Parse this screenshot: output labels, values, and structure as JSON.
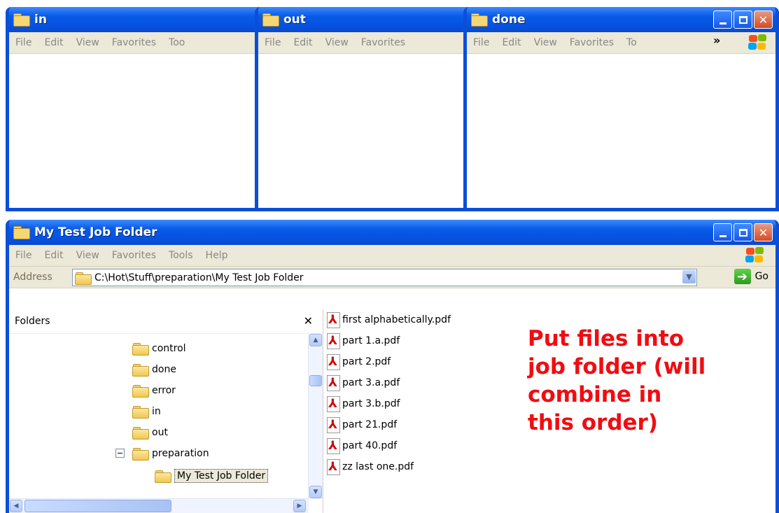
{
  "windows": {
    "in": {
      "title": "in",
      "menu": [
        "File",
        "Edit",
        "View",
        "Favorites",
        "Too"
      ]
    },
    "out": {
      "title": "out",
      "menu": [
        "File",
        "Edit",
        "View",
        "Favorites"
      ]
    },
    "done": {
      "title": "done",
      "menu": [
        "File",
        "Edit",
        "View",
        "Favorites",
        "To"
      ],
      "chevron": "»"
    }
  },
  "main": {
    "title": "My Test Job Folder",
    "menu": [
      "File",
      "Edit",
      "View",
      "Favorites",
      "Tools",
      "Help"
    ],
    "address_label": "Address",
    "address_value": "C:\\Hot\\Stuff\\preparation\\My Test Job Folder",
    "go_label": "Go",
    "folders_pane": {
      "title": "Folders",
      "close_glyph": "✕",
      "items": [
        "control",
        "done",
        "error",
        "in",
        "out",
        "preparation",
        "My Test Job Folder"
      ]
    },
    "files": [
      "first alphabetically.pdf",
      "part 1.a.pdf",
      "part 2.pdf",
      "part 3.a.pdf",
      "part 3.b.pdf",
      "part 21.pdf",
      "part 40.pdf",
      "zz last one.pdf"
    ]
  },
  "annotation": {
    "line1": "Put files into",
    "line2": "job folder (will",
    "line3": "combine in",
    "line4": "this order)"
  },
  "colors": {
    "titlebar": "#0553e1",
    "window_border": "#0b4fd8",
    "menubar": "#ece9d8",
    "annotation": "#ef0d12",
    "pdf_icon": "#d40000"
  },
  "icons": [
    "folder-icon",
    "pdf-icon",
    "minimize-icon",
    "maximize-icon",
    "close-icon",
    "go-arrow-icon",
    "windows-logo-icon"
  ]
}
